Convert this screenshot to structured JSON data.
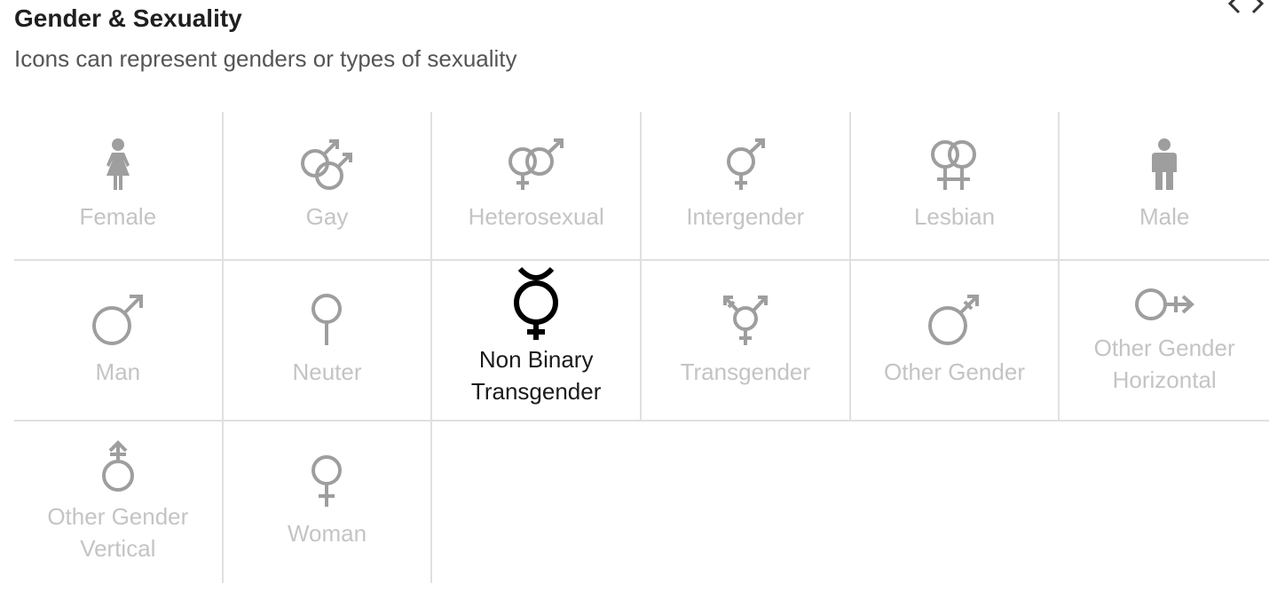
{
  "section": {
    "title": "Gender & Sexuality",
    "subtitle": "Icons can represent genders or types of sexuality"
  },
  "icons": [
    {
      "label": "Female",
      "icon": "female-person-icon"
    },
    {
      "label": "Gay",
      "icon": "gay-icon"
    },
    {
      "label": "Heterosexual",
      "icon": "heterosexual-icon"
    },
    {
      "label": "Intergender",
      "icon": "intergender-icon"
    },
    {
      "label": "Lesbian",
      "icon": "lesbian-icon"
    },
    {
      "label": "Male",
      "icon": "male-person-icon"
    },
    {
      "label": "Man",
      "icon": "man-icon"
    },
    {
      "label": "Neuter",
      "icon": "neuter-icon"
    },
    {
      "label": "Non Binary Transgender",
      "icon": "non-binary-transgender-icon",
      "selected": true
    },
    {
      "label": "Transgender",
      "icon": "transgender-icon"
    },
    {
      "label": "Other Gender",
      "icon": "other-gender-icon"
    },
    {
      "label": "Other Gender Horizontal",
      "icon": "other-gender-horizontal-icon"
    },
    {
      "label": "Other Gender Vertical",
      "icon": "other-gender-vertical-icon"
    },
    {
      "label": "Woman",
      "icon": "woman-icon"
    }
  ],
  "colors": {
    "icon_default": "#9e9e9e",
    "label_default": "#c4c4c4",
    "selected": "#000000",
    "divider": "#e0e0e0"
  }
}
